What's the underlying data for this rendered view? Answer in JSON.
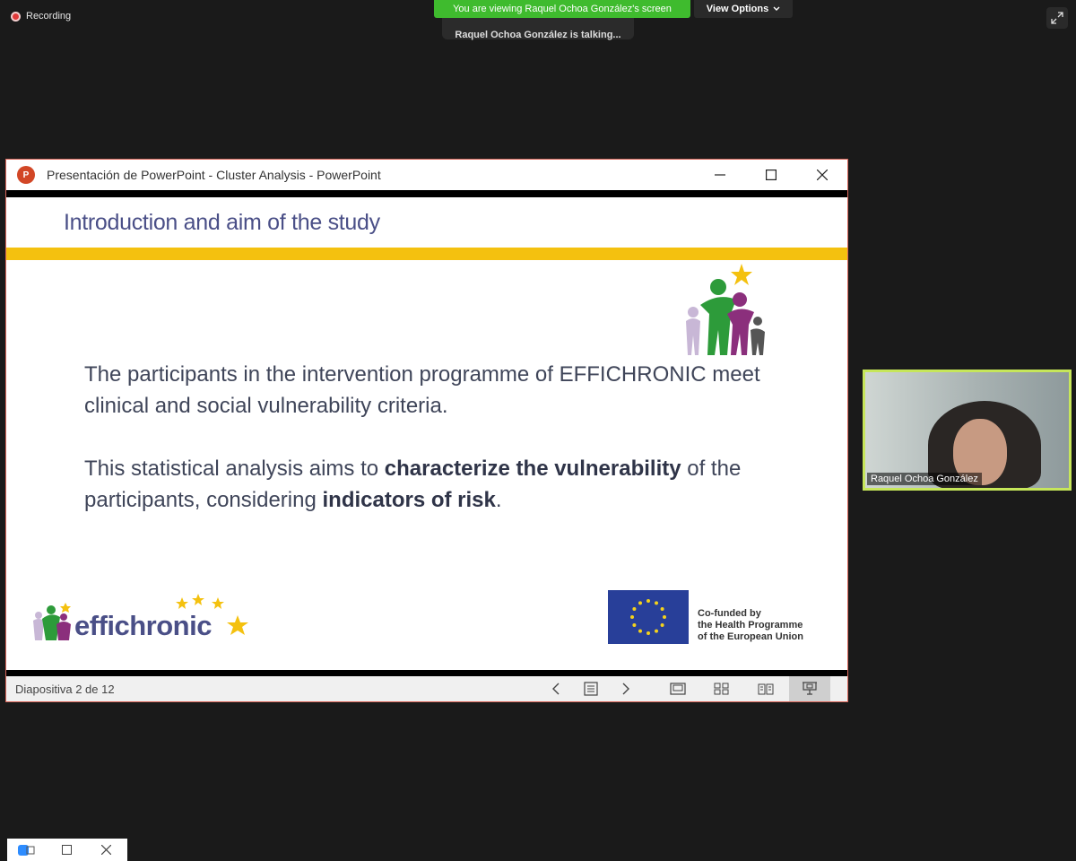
{
  "recording": {
    "label": "Recording"
  },
  "banner": {
    "text": "You are viewing Raquel Ochoa González's screen"
  },
  "view_options": {
    "label": "View Options",
    "icon": "chevron-down-icon"
  },
  "talking": {
    "text": "Raquel Ochoa González is talking..."
  },
  "ppt_window": {
    "title": "Presentación de PowerPoint  -  Cluster Analysis - PowerPoint",
    "logo_letter": "P",
    "controls": [
      "minimize",
      "maximize",
      "close"
    ]
  },
  "slide": {
    "heading": "Introduction and aim of the study",
    "para1": "The participants in the intervention programme of EFFICHRONIC meet clinical and social vulnerability criteria.",
    "para2_a": "This statistical analysis aims to ",
    "para2_b": "characterize the vulnerability",
    "para2_c": " of the participants, considering ",
    "para2_d": "indicators of risk",
    "para2_e": ".",
    "brand": "effichronic",
    "eu_line1": "Co-funded by",
    "eu_line2": "the Health Programme",
    "eu_line3": "of the European Union"
  },
  "statusbar": {
    "slide_counter": "Diapositiva 2 de 12"
  },
  "selfview": {
    "name": "Raquel Ochoa González"
  },
  "colors": {
    "banner_green": "#3fbb2e",
    "heading_blue": "#4a4f87",
    "accent_yellow": "#f4c10f",
    "selfview_border": "#c6e65a",
    "eu_blue": "#283f99"
  }
}
